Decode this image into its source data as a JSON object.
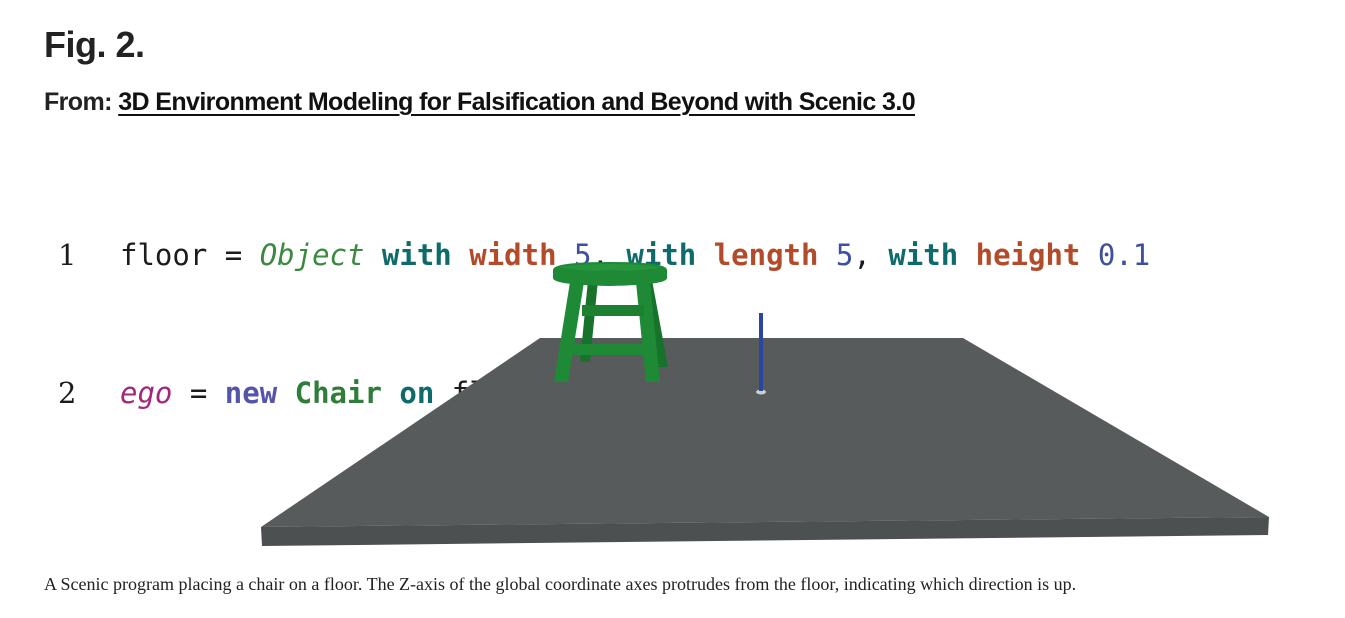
{
  "figure": {
    "label": "Fig. 2.",
    "from_prefix": "From:",
    "paper_title": "3D Environment Modeling for Falsification and Beyond with Scenic 3.0",
    "caption": "A Scenic program placing a chair on a floor. The Z-axis of the global coordinate axes protrudes from the floor, indicating which direction is up."
  },
  "code": {
    "lines": [
      {
        "number": "1",
        "tokens": {
          "var": "floor",
          "eq": " = ",
          "cls": "Object",
          "with1": " with ",
          "prop1": "width",
          "val1": " 5",
          "sep1": ", ",
          "with2": "with ",
          "prop2": "length",
          "val2": " 5",
          "sep2": ", ",
          "with3": "with ",
          "prop3": "height",
          "val3": " 0.1"
        }
      },
      {
        "number": "2",
        "tokens": {
          "var": "ego",
          "eq": " = ",
          "new": "new",
          "sp1": " ",
          "cls": "Chair",
          "sp2": " ",
          "on": "on",
          "target": " floor"
        }
      }
    ]
  },
  "scene": {
    "objects": [
      "floor",
      "chair",
      "z-axis"
    ],
    "colors": {
      "floor_top": "#575b5b",
      "floor_side": "#4d5050",
      "chair": "#1f8a35",
      "chair_shade": "#17732b",
      "axis": "#2a46a0"
    }
  }
}
